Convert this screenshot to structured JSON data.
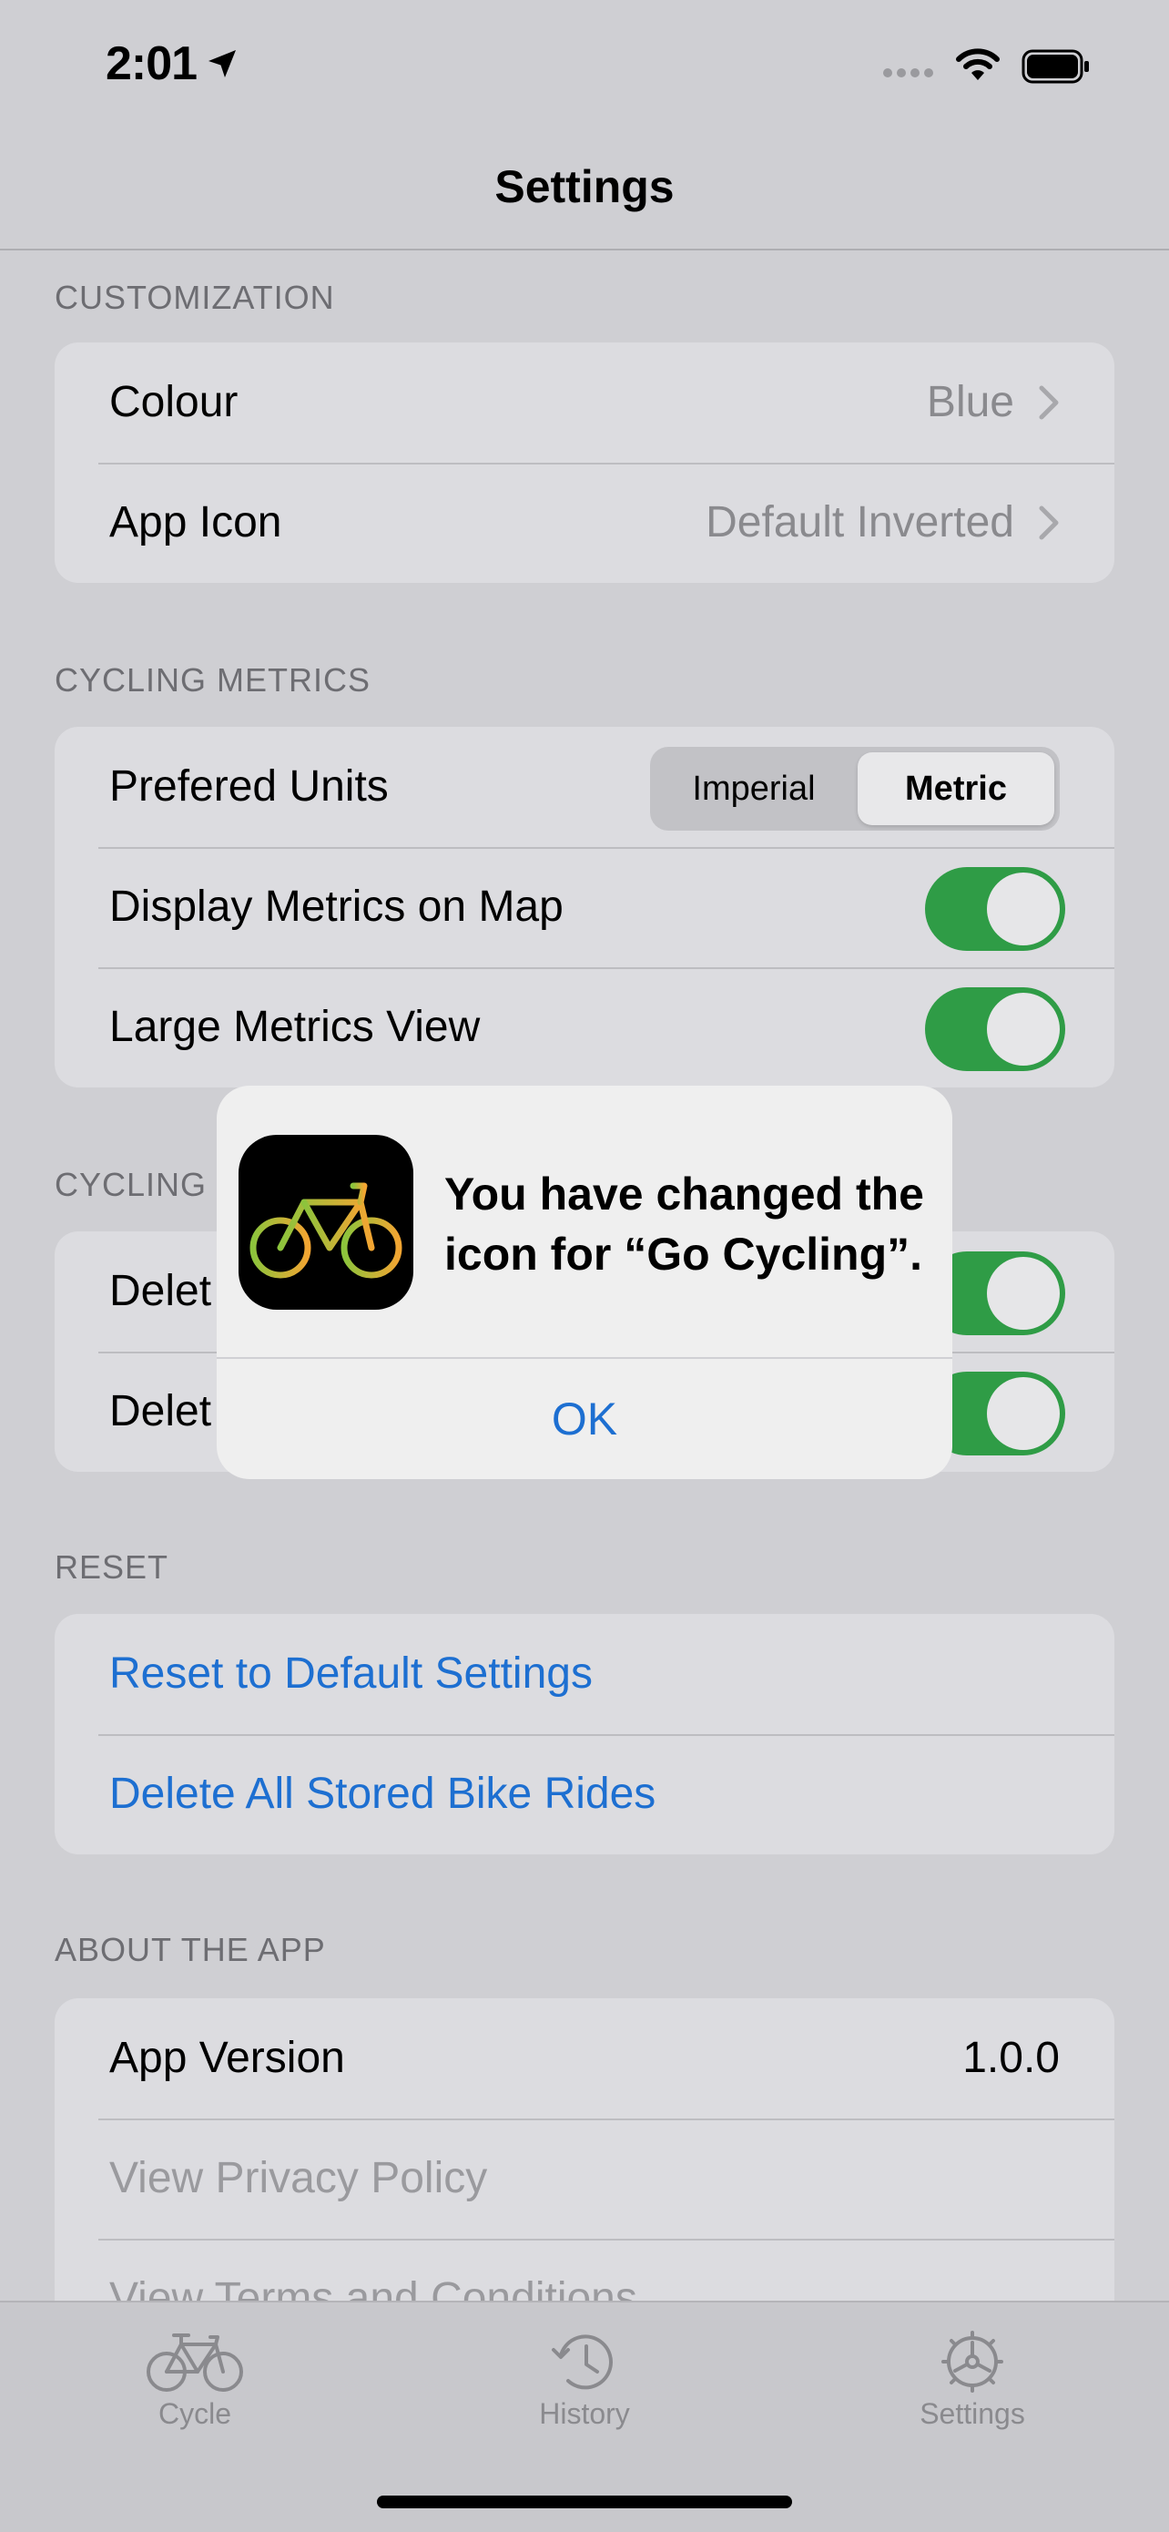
{
  "status_bar": {
    "time": "2:01"
  },
  "nav": {
    "title": "Settings"
  },
  "sections": {
    "customization": {
      "header": "CUSTOMIZATION",
      "colour_label": "Colour",
      "colour_value": "Blue",
      "app_icon_label": "App Icon",
      "app_icon_value": "Default Inverted"
    },
    "cycling_metrics": {
      "header": "CYCLING METRICS",
      "units_label": "Prefered Units",
      "units_options": [
        "Imperial",
        "Metric"
      ],
      "units_selected": "Metric",
      "display_map_label": "Display Metrics on Map",
      "display_map_on": true,
      "large_view_label": "Large Metrics View",
      "large_view_on": true
    },
    "cycling_partial": {
      "header": "CYCLING",
      "row1_label": "Delet",
      "row1_on": true,
      "row2_label": "Delet",
      "row2_on": true
    },
    "reset": {
      "header": "RESET",
      "reset_label": "Reset to Default Settings",
      "delete_label": "Delete All Stored Bike Rides"
    },
    "about": {
      "header": "ABOUT THE APP",
      "version_label": "App Version",
      "version_value": "1.0.0",
      "privacy_label": "View Privacy Policy",
      "terms_label": "View Terms and Conditions"
    }
  },
  "alert": {
    "message": "You have changed the icon for “Go Cycling”.",
    "ok_label": "OK"
  },
  "tabs": [
    {
      "label": "Cycle",
      "icon": "bicycle-icon"
    },
    {
      "label": "History",
      "icon": "history-clock-icon"
    },
    {
      "label": "Settings",
      "icon": "gear-icon"
    }
  ],
  "colors": {
    "accent": "#1d6fd1",
    "toggle_on": "#2f9c46"
  }
}
